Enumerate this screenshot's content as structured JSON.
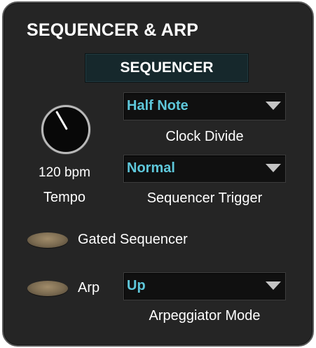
{
  "panel": {
    "title": "SEQUENCER & ARP",
    "sequencer_button_label": "SEQUENCER"
  },
  "tempo": {
    "value_label": "120 bpm",
    "caption": "Tempo"
  },
  "clock_divide": {
    "selected": "Half Note",
    "caption": "Clock Divide"
  },
  "sequencer_trigger": {
    "selected": "Normal",
    "caption": "Sequencer Trigger"
  },
  "gated_sequencer": {
    "label": "Gated Sequencer",
    "state": "off"
  },
  "arp": {
    "label": "Arp",
    "state": "off",
    "mode_selected": "Up",
    "mode_caption": "Arpeggiator Mode"
  },
  "colors": {
    "panel_background": "#252525",
    "text": "#ffffff",
    "dropdown_value": "#5ec7da",
    "toggle_off": "#8f7c5f"
  }
}
